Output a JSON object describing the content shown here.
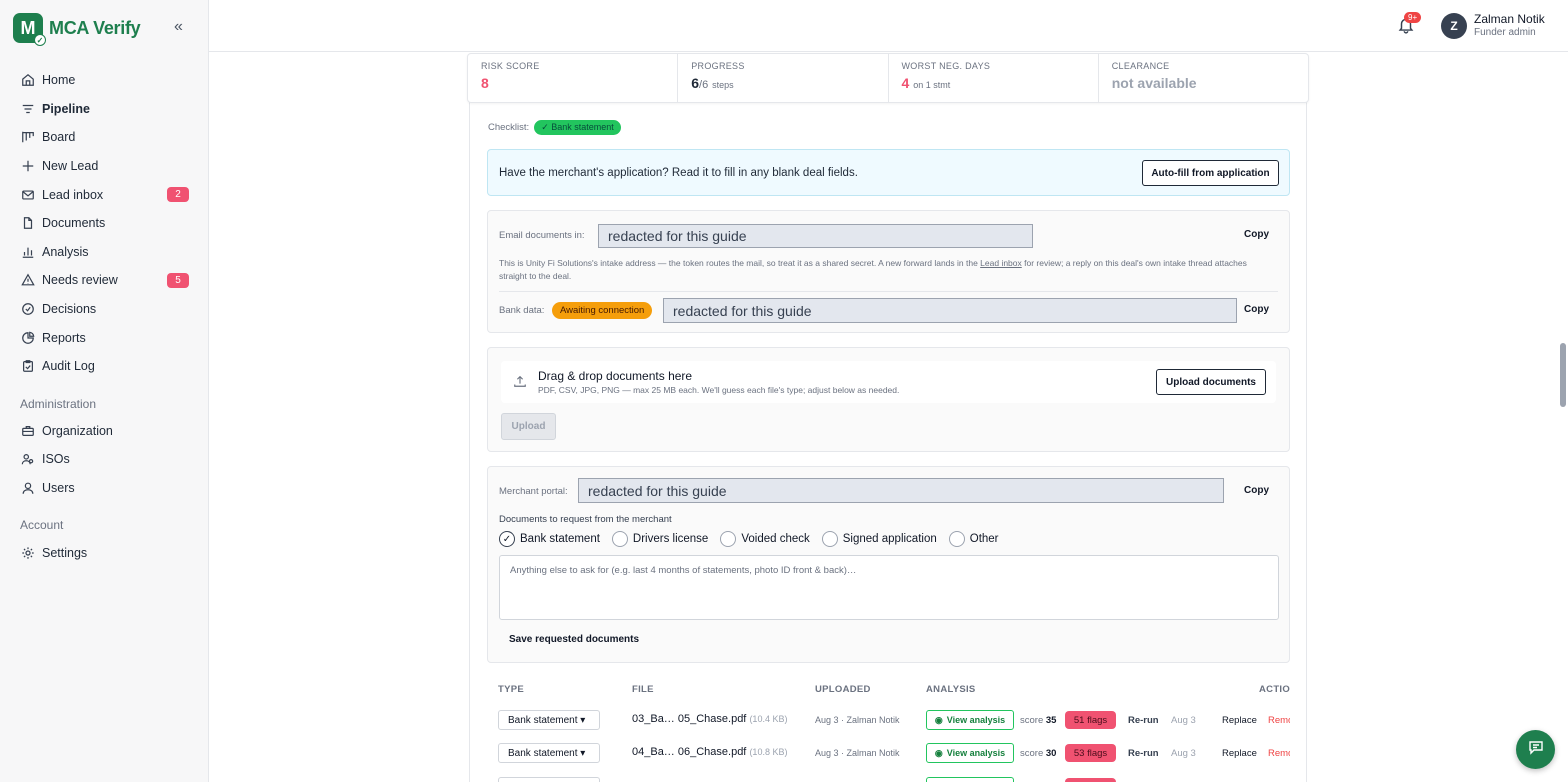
{
  "app": {
    "name": "MCA Verify",
    "logo_letter": "M"
  },
  "sidebar": {
    "items": [
      {
        "label": "Home",
        "icon": "home-icon"
      },
      {
        "label": "Pipeline",
        "icon": "filter-icon",
        "active": true
      },
      {
        "label": "Board",
        "icon": "board-icon"
      },
      {
        "label": "New Lead",
        "icon": "plus-icon"
      },
      {
        "label": "Lead inbox",
        "icon": "mail-icon",
        "badge": "2"
      },
      {
        "label": "Documents",
        "icon": "document-icon"
      },
      {
        "label": "Analysis",
        "icon": "bar-chart-icon"
      },
      {
        "label": "Needs review",
        "icon": "warning-icon",
        "badge": "5"
      },
      {
        "label": "Decisions",
        "icon": "check-circle-icon"
      },
      {
        "label": "Reports",
        "icon": "pie-chart-icon"
      },
      {
        "label": "Audit Log",
        "icon": "clipboard-icon"
      }
    ],
    "admin_section": "Administration",
    "admin_items": [
      {
        "label": "Organization",
        "icon": "briefcase-icon"
      },
      {
        "label": "ISOs",
        "icon": "users-group-icon"
      },
      {
        "label": "Users",
        "icon": "user-icon"
      }
    ],
    "account_section": "Account",
    "account_items": [
      {
        "label": "Settings",
        "icon": "gear-icon"
      }
    ]
  },
  "header": {
    "notification_badge": "9+",
    "user_initial": "Z",
    "user_name": "Zalman Notik",
    "user_role": "Funder admin"
  },
  "stats": {
    "risk_label": "RISK SCORE",
    "risk_value": "8",
    "progress_label": "PROGRESS",
    "progress_value": "6",
    "progress_total": "/6",
    "progress_unit": "steps",
    "worst_label": "WORST NEG. DAYS",
    "worst_value": "4",
    "worst_sub": "on 1 stmt",
    "clearance_label": "CLEARANCE",
    "clearance_value": "not available"
  },
  "checklist": {
    "label": "Checklist:",
    "pill": "✓ Bank statement"
  },
  "autofill": {
    "text": "Have the merchant's application? Read it to fill in any blank deal fields.",
    "button": "Auto-fill from application"
  },
  "intake": {
    "email_label": "Email documents in:",
    "email_value": "redacted for this guide",
    "copy_label": "Copy",
    "note_pre": "This is Unity Fi Solutions's intake address — the token routes the mail, so treat it as a shared secret. A new forward lands in the ",
    "note_link": "Lead inbox",
    "note_post": " for review; a reply on this deal's own intake thread attaches straight to the deal.",
    "bank_label": "Bank data:",
    "bank_status": "Awaiting connection",
    "bank_value": "redacted for this guide"
  },
  "upload": {
    "title": "Drag & drop documents here",
    "subtitle": "PDF, CSV, JPG, PNG — max 25 MB each. We'll guess each file's type; adjust below as needed.",
    "upload_docs_button": "Upload documents",
    "upload_button": "Upload"
  },
  "portal": {
    "label": "Merchant portal:",
    "value": "redacted for this guide",
    "copy_label": "Copy",
    "request_label": "Documents to request from the merchant",
    "options": [
      {
        "label": "Bank statement",
        "checked": true
      },
      {
        "label": "Drivers license",
        "checked": false
      },
      {
        "label": "Voided check",
        "checked": false
      },
      {
        "label": "Signed application",
        "checked": false
      },
      {
        "label": "Other",
        "checked": false
      }
    ],
    "textarea_placeholder": "Anything else to ask for (e.g. last 4 months of statements, photo ID front & back)…",
    "save_button": "Save requested documents"
  },
  "table": {
    "headers": {
      "type": "TYPE",
      "file": "FILE",
      "uploaded": "UPLOADED",
      "analysis": "ANALYSIS",
      "actions": "ACTIO"
    },
    "rows": [
      {
        "type": "Bank statement ▾",
        "file": "03_Ba… 05_Chase.pdf",
        "size": "(10.4 KB)",
        "uploaded": "Aug 3 · Zalman Notik",
        "view": "View analysis",
        "score_label": "score",
        "score": "35",
        "flags": "51 flags",
        "rerun": "Re-run",
        "date": "Aug 3",
        "replace": "Replace",
        "remove": "Remove"
      },
      {
        "type": "Bank statement ▾",
        "file": "04_Ba… 06_Chase.pdf",
        "size": "(10.8 KB)",
        "uploaded": "Aug 3 · Zalman Notik",
        "view": "View analysis",
        "score_label": "score",
        "score": "30",
        "flags": "53 flags",
        "rerun": "Re-run",
        "date": "Aug 3",
        "replace": "Replace",
        "remove": "Remove"
      }
    ]
  },
  "colors": {
    "brand": "#1e7f4e",
    "danger": "#f05271",
    "warning": "#f59e0b",
    "success": "#22c55e"
  }
}
